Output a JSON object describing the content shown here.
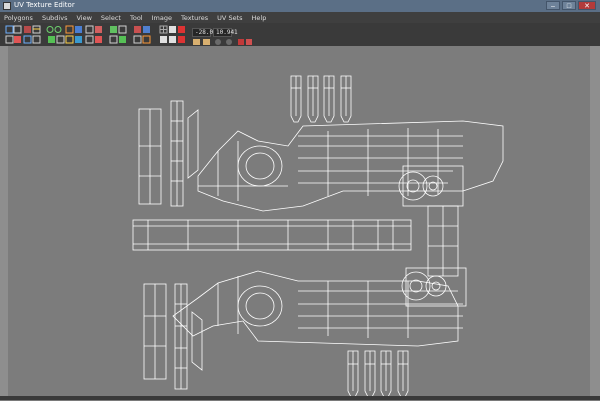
{
  "window": {
    "title": "UV Texture Editor",
    "subtitle": "",
    "minimize_glyph": "–",
    "maximize_glyph": "□",
    "close_glyph": "✕"
  },
  "menubar": {
    "items": [
      "Polygons",
      "Subdivs",
      "View",
      "Select",
      "Tool",
      "Image",
      "Textures",
      "UV Sets",
      "Help"
    ]
  },
  "toolbar": {
    "u_value": "-28.064",
    "v_value": "10.941"
  },
  "colors": {
    "viewport_bg": "#7c7c7c",
    "wireframe": "#ffffff",
    "titlebar": "#5b6f86",
    "toolbar": "#3a3a3a"
  }
}
